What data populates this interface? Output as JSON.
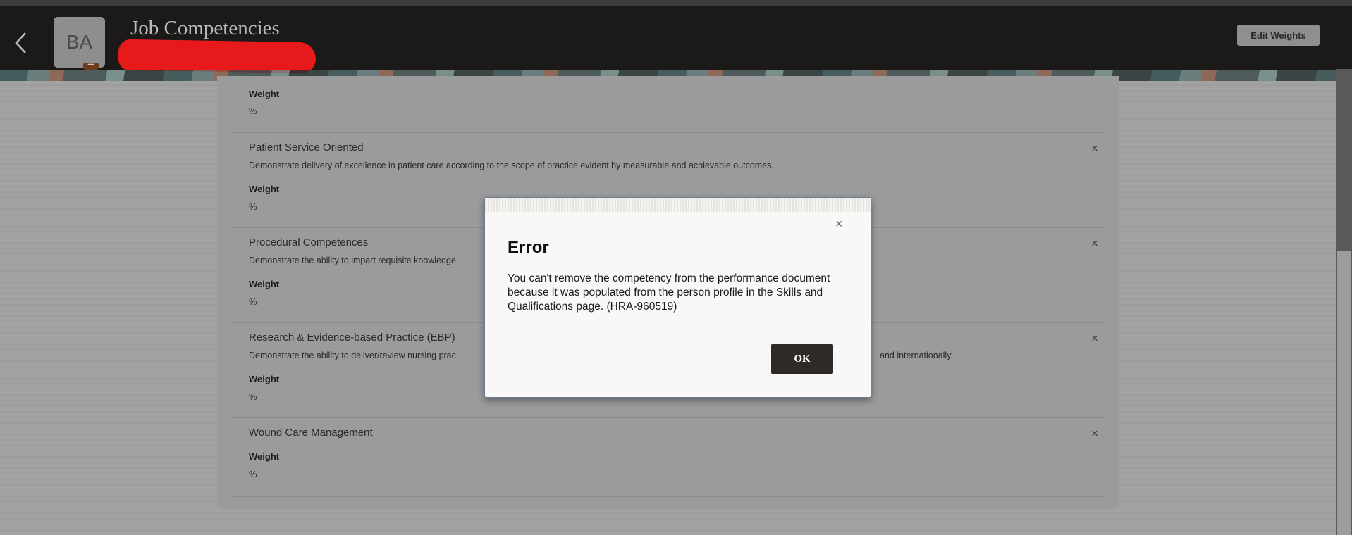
{
  "header": {
    "title": "Job Competencies",
    "avatar_initials": "BA",
    "more_label": "•••",
    "edit_weights_label": "Edit Weights"
  },
  "competencies": [
    {
      "title": "",
      "description": "",
      "weight_label": "Weight",
      "weight_value": "%"
    },
    {
      "title": "Patient Service Oriented",
      "description": "Demonstrate delivery of excellence in patient care according to the scope of practice evident by measurable and achievable outcomes.",
      "weight_label": "Weight",
      "weight_value": "%"
    },
    {
      "title": "Procedural Competences",
      "description": "Demonstrate the ability to impart requisite knowledge",
      "description_tail": "",
      "weight_label": "Weight",
      "weight_value": "%"
    },
    {
      "title": "Research & Evidence-based Practice (EBP)",
      "description": "Demonstrate the ability to deliver/review nursing prac",
      "description_tail": "and internationally.",
      "weight_label": "Weight",
      "weight_value": "%"
    },
    {
      "title": "Wound Care Management",
      "description": "",
      "weight_label": "Weight",
      "weight_value": "%"
    }
  ],
  "icons": {
    "remove": "×",
    "back": "chevron-left"
  },
  "dialog": {
    "title": "Error",
    "message": "You can't remove the competency from the performance document because it was populated from the person profile in the Skills and Qualifications page. (HRA-960519)",
    "ok_label": "OK",
    "close": "×"
  }
}
